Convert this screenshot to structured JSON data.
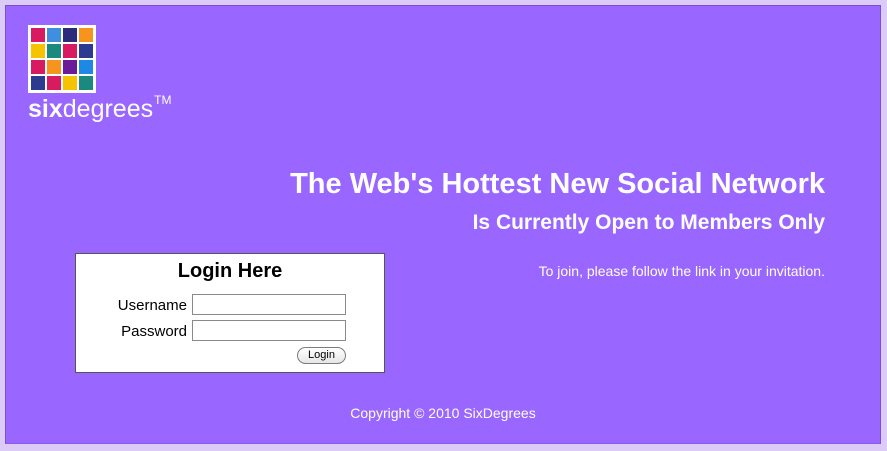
{
  "brand": {
    "name_bold": "six",
    "name_light": "degrees",
    "trademark": "TM",
    "logo_colors": [
      "#d81b60",
      "#3f8fe0",
      "#2c2a7a",
      "#f7941d",
      "#f5c400",
      "#1a8a7e",
      "#d81b60",
      "#2c3a8f",
      "#d81b60",
      "#f7941d",
      "#6a1b9a",
      "#1e88e5",
      "#2c3a8f",
      "#d81b60",
      "#f5c400",
      "#1a8a7e"
    ]
  },
  "hero": {
    "headline": "The Web's Hottest New Social Network",
    "subheadline": "Is Currently Open to Members Only",
    "join_text": "To join, please follow the link in your invitation."
  },
  "login": {
    "title": "Login Here",
    "username_label": "Username",
    "username_value": "",
    "password_label": "Password",
    "password_value": "",
    "button_label": "Login"
  },
  "footer": {
    "copyright": "Copyright © 2010 SixDegrees"
  },
  "colors": {
    "background": "#9966ff",
    "text": "#ffffff",
    "panel": "#ffffff"
  }
}
